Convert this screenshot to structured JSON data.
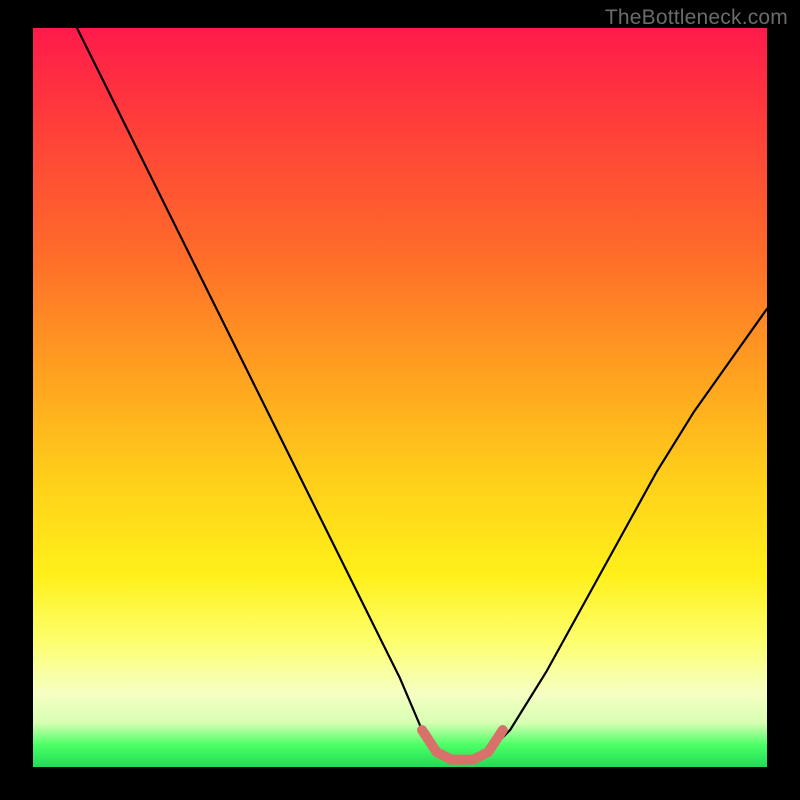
{
  "watermark": {
    "text": "TheBottleneck.com"
  },
  "chart_data": {
    "type": "line",
    "title": "",
    "xlabel": "",
    "ylabel": "",
    "xlim": [
      0,
      100
    ],
    "ylim": [
      0,
      100
    ],
    "series": [
      {
        "name": "bottleneck-curve",
        "x": [
          6,
          10,
          15,
          20,
          25,
          30,
          35,
          40,
          45,
          50,
          53,
          55,
          57,
          60,
          62,
          65,
          70,
          75,
          80,
          85,
          90,
          95,
          100
        ],
        "y": [
          100,
          92,
          82,
          72,
          62,
          52,
          42,
          32,
          22,
          12,
          5,
          2,
          1,
          1,
          2,
          5,
          13,
          22,
          31,
          40,
          48,
          55,
          62
        ]
      },
      {
        "name": "optimal-band",
        "x": [
          53,
          55,
          57,
          60,
          62,
          64
        ],
        "y": [
          5,
          2,
          1,
          1,
          2,
          5
        ]
      }
    ],
    "colors": {
      "curve": "#000000",
      "optimal_band": "#d9716b",
      "gradient_top": "#ff1a4b",
      "gradient_bottom": "#1fdd55"
    }
  }
}
